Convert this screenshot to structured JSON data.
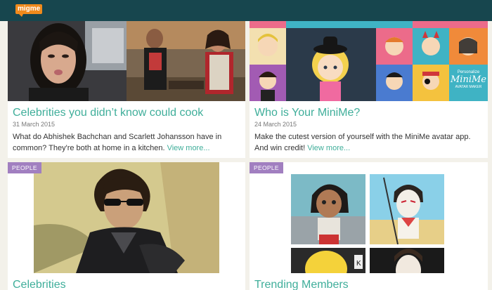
{
  "header": {
    "logo_text": "migme"
  },
  "cards": [
    {
      "title": "Celebrities you didn’t know could cook",
      "date": "31 March 2015",
      "description": "What do Abhishek Bachchan and Scarlett Johansson have in common? They're both at home in a kitchen.",
      "link": "View more..."
    },
    {
      "title": "Who is Your MiniMe?",
      "date": "24 March 2015",
      "description": "Make the cutest version of yourself with the MiniMe avatar app. And win credit!",
      "link": "View more...",
      "promo_top": "Personalize",
      "promo_main": "MiniMe",
      "promo_sub": "AVATAR MAKER"
    },
    {
      "tag": "PEOPLE",
      "title": "Celebrities"
    },
    {
      "tag": "PEOPLE",
      "title": "Trending Members"
    }
  ],
  "colors": {
    "header_bg": "#17464e",
    "logo_bg": "#f08a1c",
    "accent": "#3fae9a",
    "tag_bg": "#a17fc0",
    "page_bg": "#f3f1ea"
  }
}
